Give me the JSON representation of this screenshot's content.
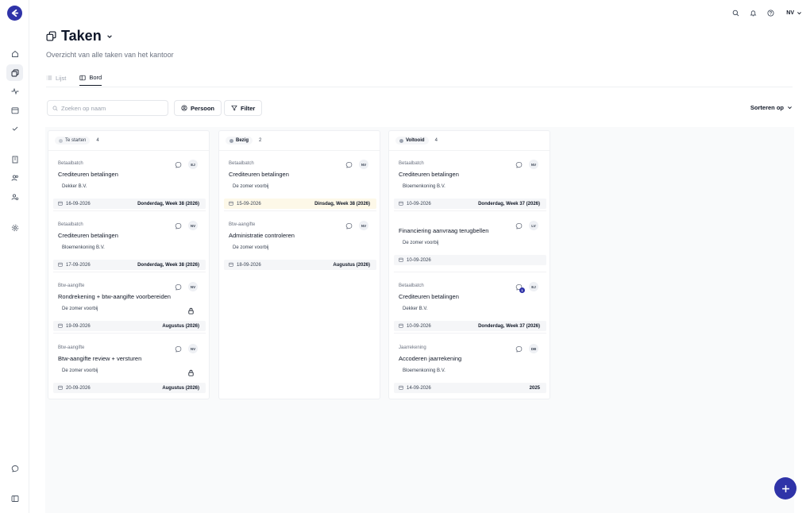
{
  "app": {
    "page_title": "Taken",
    "subtitle": "Overzicht van alle taken van het kantoor",
    "user_initials": "NV",
    "brand_color": "#2f33a8"
  },
  "tabs": [
    {
      "label": "Lijst",
      "active": false
    },
    {
      "label": "Bord",
      "active": true
    }
  ],
  "toolbar": {
    "search_placeholder": "Zoeken op naam",
    "person_label": "Persoon",
    "filter_label": "Filter",
    "sort_label": "Sorteren op"
  },
  "columns": [
    {
      "name": "Te starten",
      "count": "4",
      "cards": [
        {
          "category": "Betaalbatch",
          "title": "Crediteuren betalingen",
          "client": "Dekker B.V.",
          "date": "16-09-2026",
          "due": "Donderdag, Week 38 (2026)",
          "assignee": "EJ"
        },
        {
          "category": "Betaalbatch",
          "title": "Crediteuren betalingen",
          "client": "Bloemenkoning B.V.",
          "date": "17-09-2026",
          "due": "Donderdag, Week 38 (2026)",
          "assignee": "NV"
        },
        {
          "category": "Btw-aangifte",
          "title": "Rondrekening + btw-aangifte voorbereiden",
          "client": "De zomer voorbij",
          "date": "19-09-2026",
          "due": "Augustus (2026)",
          "assignee": "NV"
        },
        {
          "category": "Btw-aangifte",
          "title": "Btw-aangifte review + versturen",
          "client": "De zomer voorbij",
          "date": "20-09-2026",
          "due": "Augustus (2026)",
          "assignee": "NV"
        }
      ]
    },
    {
      "name": "Bezig",
      "count": "2",
      "cards": [
        {
          "category": "Betaalbatch",
          "title": "Crediteuren betalingen",
          "client": "De zomer voorbij",
          "date": "15-09-2026",
          "due": "Dinsdag, Week 38 (2026)",
          "assignee": "NV"
        },
        {
          "category": "Btw-aangifte",
          "title": "Administratie controleren",
          "client": "De zomer voorbij",
          "date": "18-09-2026",
          "due": "Augustus (2026)",
          "assignee": "NV"
        }
      ]
    },
    {
      "name": "Voltooid",
      "count": "4",
      "cards": [
        {
          "category": "Betaalbatch",
          "title": "Crediteuren betalingen",
          "client": "Bloemenkoning B.V.",
          "date": "10-09-2026",
          "due": "Donderdag, Week 37 (2026)",
          "assignee": "NV"
        },
        {
          "category": "",
          "title": "Financiering aanvraag terugbellen",
          "client": "De zomer voorbij",
          "date": "10-09-2026",
          "due": "",
          "assignee": "LV"
        },
        {
          "category": "Betaalbatch",
          "title": "Crediteuren betalingen",
          "client": "Dekker B.V.",
          "date": "10-09-2026",
          "due": "Donderdag, Week 37 (2026)",
          "assignee": "EJ",
          "comments": "1"
        },
        {
          "category": "Jaarrekening",
          "title": "Accoderen jaarrekening",
          "client": "Bloemenkoning B.V.",
          "date": "14-09-2026",
          "due": "2025",
          "assignee": "DB"
        }
      ]
    }
  ]
}
